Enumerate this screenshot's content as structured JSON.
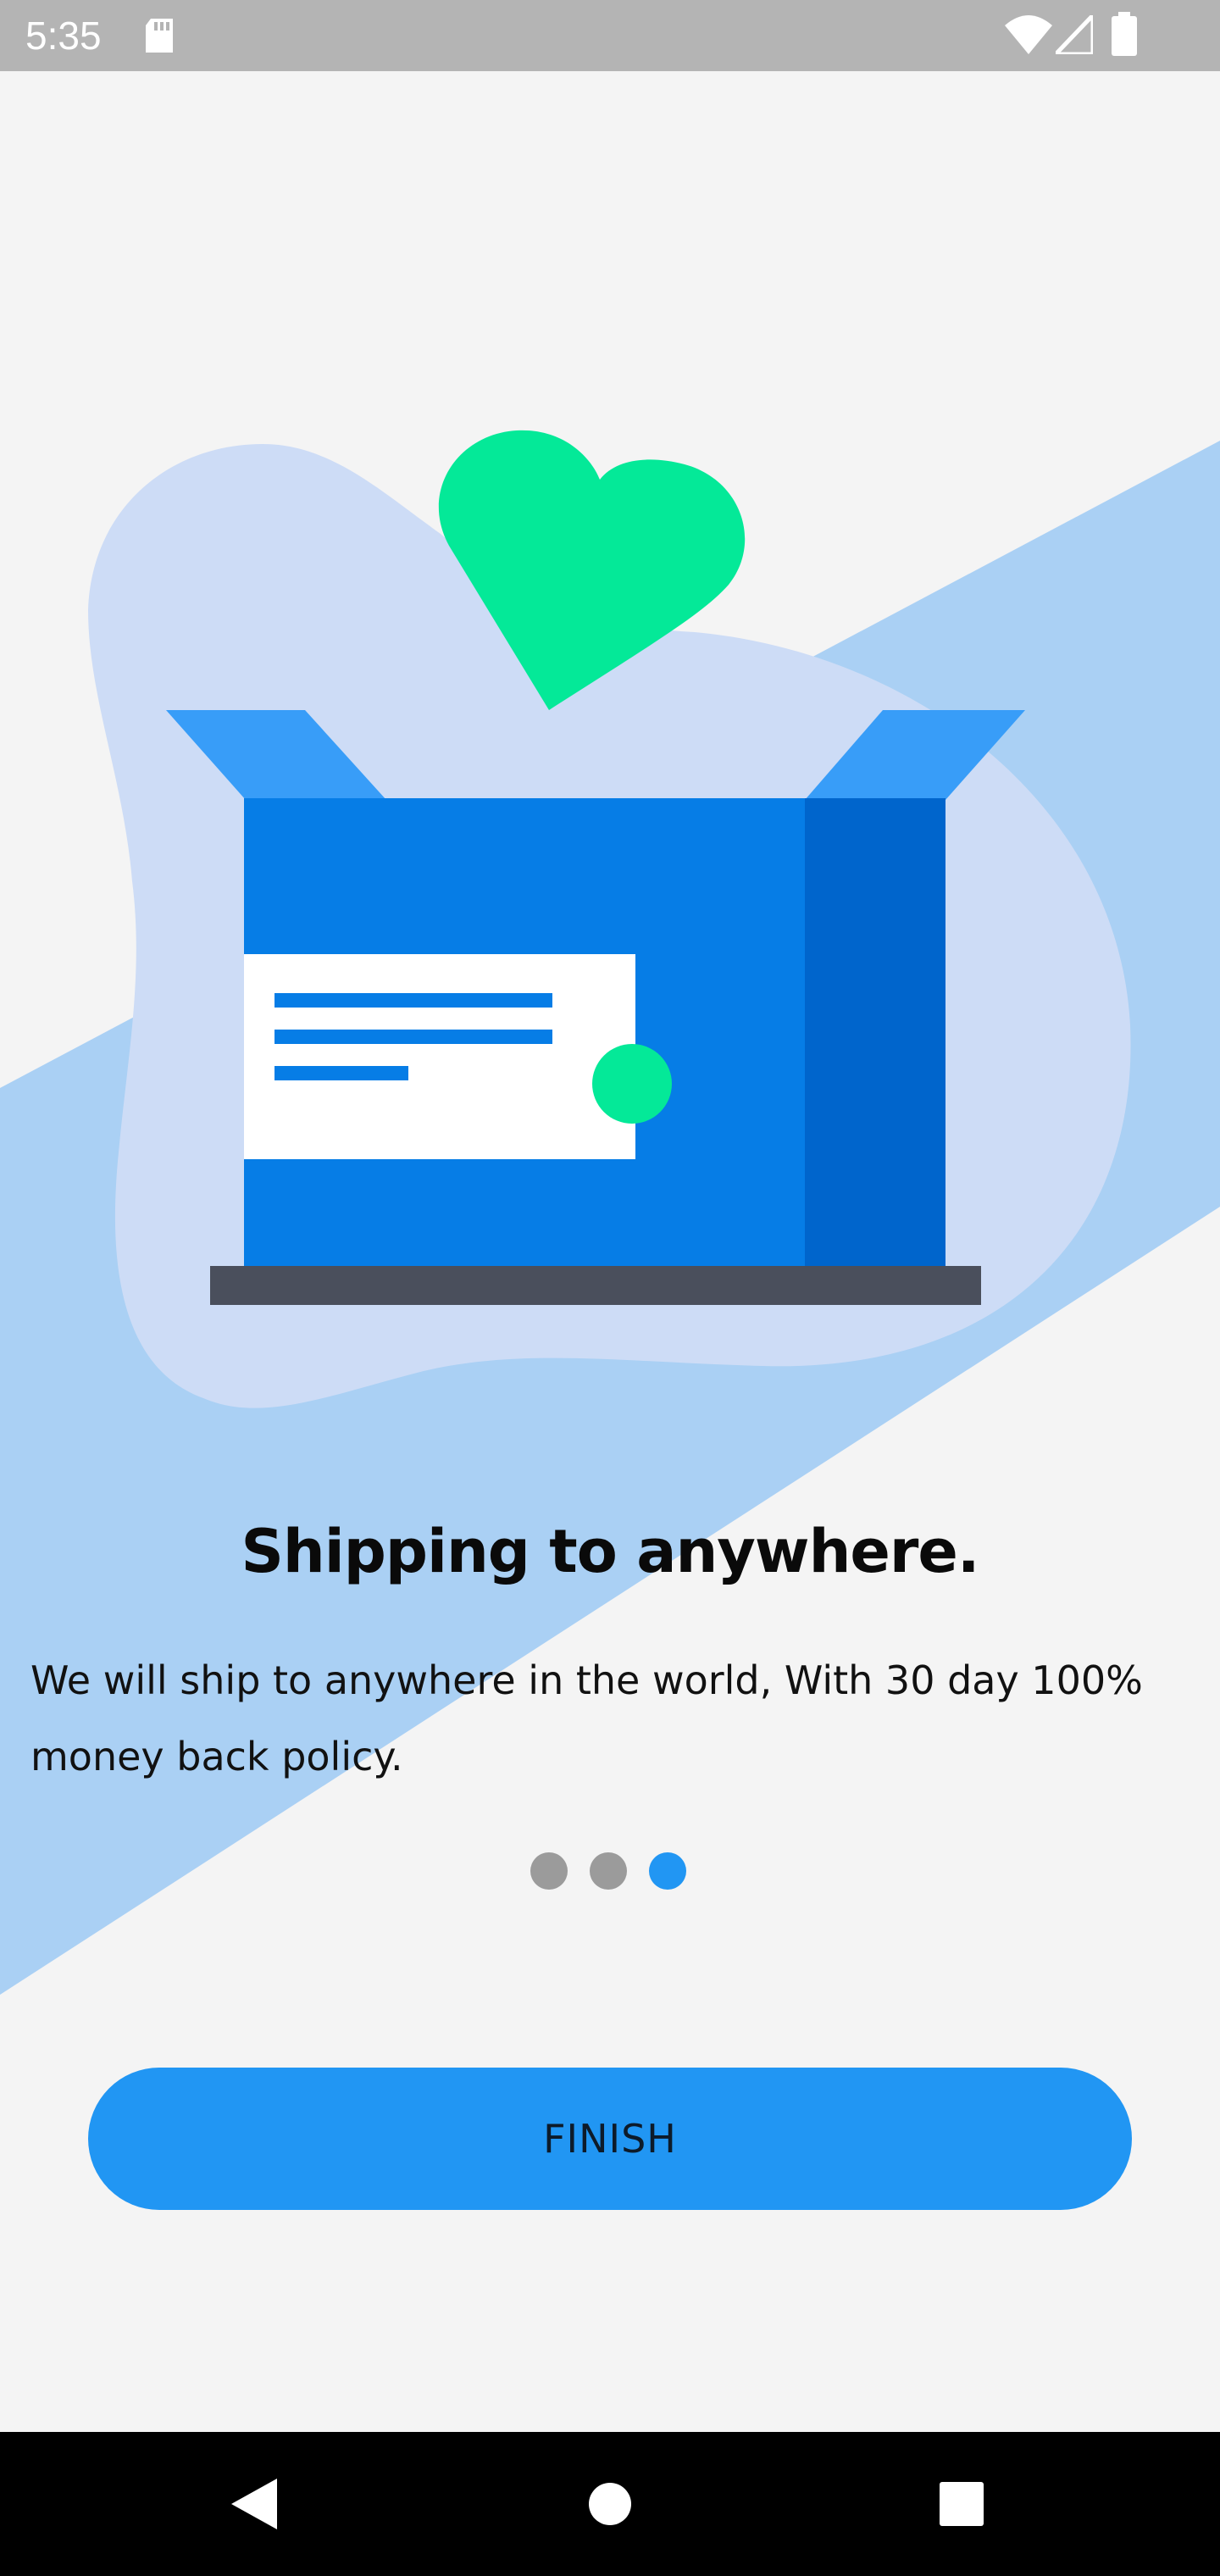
{
  "status_bar": {
    "time": "5:35",
    "icons": [
      "sd-card-icon",
      "wifi-icon",
      "cellular-signal-icon",
      "battery-icon"
    ]
  },
  "onboarding": {
    "illustration": "open-shipping-box-with-heart",
    "title": "Shipping to anywhere.",
    "description": "We will ship to anywhere in the world, With 30 day 100% money back policy.",
    "page_count": 3,
    "current_page": 3
  },
  "finish_button": {
    "label": "FINISH"
  },
  "nav_bar": {
    "icons": [
      "back-icon",
      "home-icon",
      "recents-icon"
    ]
  },
  "colors": {
    "background": "#f4f4f4",
    "stripe": "#aad0f4",
    "blob": "#cddcf6",
    "heart": "#04e998",
    "box_front": "#067de6",
    "box_side": "#0065cc",
    "box_flap": "#389df8",
    "accent": "#2196f3",
    "dot_inactive": "#9b9b9b"
  }
}
